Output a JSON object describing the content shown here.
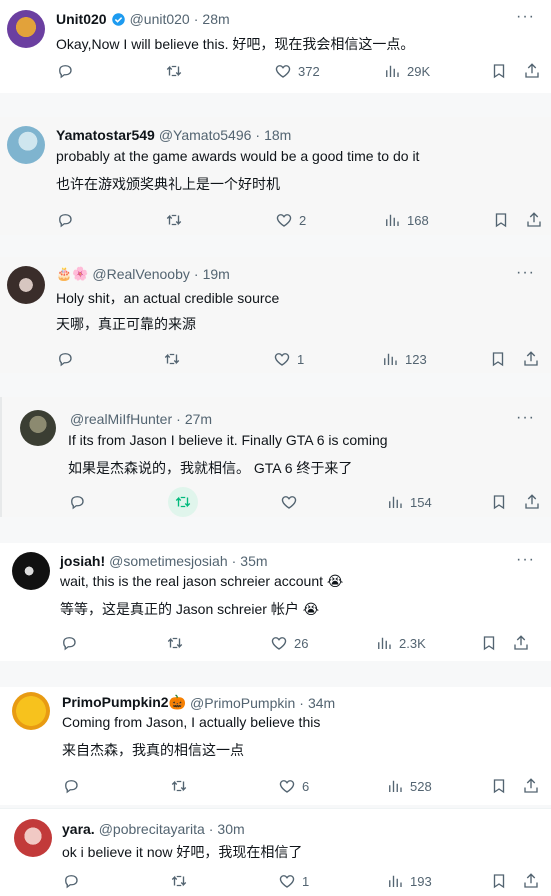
{
  "colors": {
    "accent_green": "#00ba7c",
    "verified_blue": "#1d9bf0",
    "muted": "#536471"
  },
  "tweets": [
    {
      "name": "Unit020",
      "handle": "@unit020",
      "time": "28m",
      "verified": true,
      "line1": "Okay,Now I will believe this. 好吧，现在我会相信这一点。",
      "line2": "",
      "reply": "",
      "retweet": "",
      "like": "372",
      "views": "29K"
    },
    {
      "name": "Yamatostar549",
      "handle": "@Yamato5496",
      "time": "18m",
      "line1": "probably at the game awards would be a good time to do it",
      "line2": "也许在游戏颁奖典礼上是一个好时机",
      "reply": "",
      "retweet": "",
      "like": "2",
      "views": "168"
    },
    {
      "name": "",
      "handle": "@RealVenooby",
      "time": "19m",
      "line1": "Holy shit，an actual credible source",
      "line2": "天哪，真正可靠的来源",
      "reply": "",
      "retweet": "",
      "like": "1",
      "views": "123"
    },
    {
      "name": "",
      "handle": "@realMiIfHunter",
      "time": "27m",
      "line1": "If its from Jason I believe it. Finally GTA 6 is coming",
      "line2": "如果是杰森说的，我就相信。 GTA 6 终于来了",
      "reply": "",
      "retweet": "",
      "like": "",
      "views": "154"
    },
    {
      "name": "josiah!",
      "handle": "@sometimesjosiah",
      "time": "35m",
      "line1": "wait, this is the real jason schreier account 😭",
      "line2": "等等，这是真正的 Jason schreier 帐户 😭",
      "reply": "",
      "retweet": "",
      "like": "26",
      "views": "2.3K"
    },
    {
      "name": "PrimoPumpkin2🎃",
      "handle": "@PrimoPumpkin",
      "time": "34m",
      "line1": "Coming from Jason, I actually believe this",
      "line2": "来自杰森，我真的相信这一点",
      "reply": "",
      "retweet": "",
      "like": "6",
      "views": "528"
    },
    {
      "name": "yara.",
      "handle": "@pobrecitayarita",
      "time": "30m",
      "line1": "ok i believe it now 好吧，我现在相信了",
      "line2": "",
      "reply": "",
      "retweet": "",
      "like": "1",
      "views": "193"
    }
  ],
  "icons": {
    "reply": "reply-icon",
    "retweet": "retweet-icon",
    "like": "heart-icon",
    "views": "views-icon",
    "bookmark": "bookmark-icon",
    "share": "share-icon",
    "more": "more-icon"
  }
}
